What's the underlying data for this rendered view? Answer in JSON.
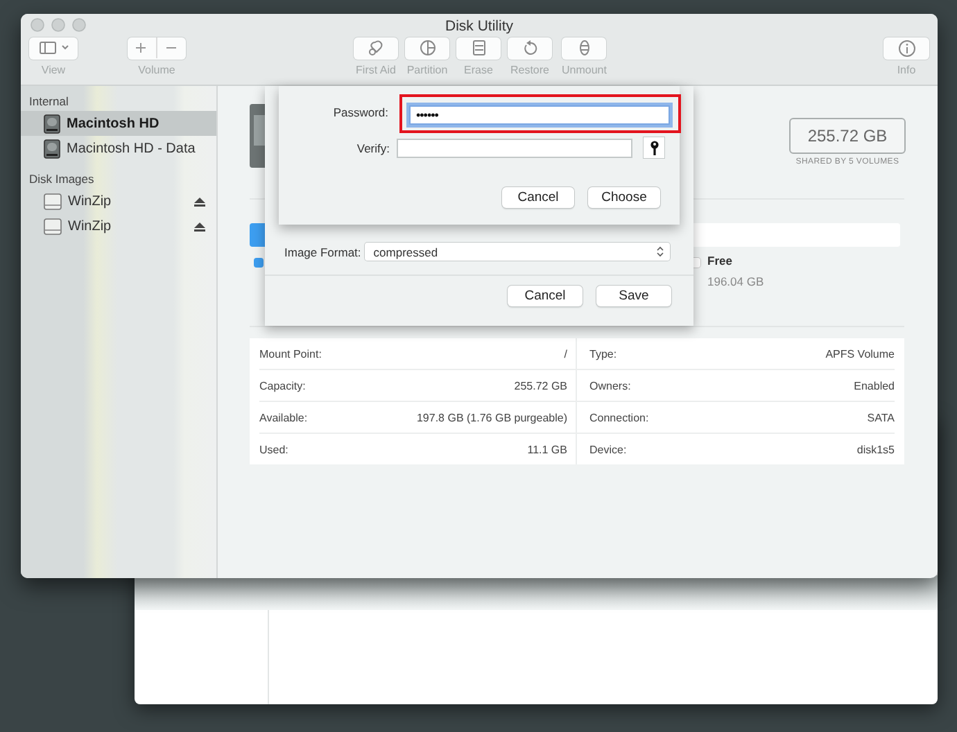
{
  "window": {
    "title": "Disk Utility"
  },
  "toolbar": [
    {
      "kind": "view",
      "label": "View"
    },
    {
      "kind": "volume",
      "label": "Volume"
    },
    {
      "kind": "first_aid",
      "label": "First Aid"
    },
    {
      "kind": "partition",
      "label": "Partition"
    },
    {
      "kind": "erase",
      "label": "Erase"
    },
    {
      "kind": "restore",
      "label": "Restore"
    },
    {
      "kind": "unmount",
      "label": "Unmount"
    },
    {
      "kind": "info",
      "label": "Info"
    }
  ],
  "sidebar": {
    "sections": [
      {
        "heading": "Internal",
        "items": [
          {
            "kind": "drive",
            "label": "Macintosh HD",
            "selected": true,
            "ejectable": false
          },
          {
            "kind": "drive",
            "label": "Macintosh HD - Data",
            "selected": false,
            "ejectable": false
          }
        ]
      },
      {
        "heading": "Disk Images",
        "items": [
          {
            "kind": "image",
            "label": "WinZip",
            "selected": false,
            "ejectable": true
          },
          {
            "kind": "image",
            "label": "WinZip",
            "selected": false,
            "ejectable": true
          }
        ]
      }
    ]
  },
  "volume": {
    "capacity": "255.72 GB",
    "capacity_note": "SHARED BY 5 VOLUMES",
    "legend": [
      {
        "color": "#3d9ef0"
      },
      {
        "label": "Free",
        "value": "196.04 GB",
        "color": "#ffffff"
      }
    ],
    "info": [
      {
        "label": "Mount Point:",
        "value": "/"
      },
      {
        "label": "Type:",
        "value": "APFS Volume"
      },
      {
        "label": "Capacity:",
        "value": "255.72 GB"
      },
      {
        "label": "Owners:",
        "value": "Enabled"
      },
      {
        "label": "Available:",
        "value": "197.8 GB (1.76 GB purgeable)"
      },
      {
        "label": "Connection:",
        "value": "SATA"
      },
      {
        "label": "Used:",
        "value": "11.1 GB"
      },
      {
        "label": "Device:",
        "value": "disk1s5"
      }
    ]
  },
  "save_sheet": {
    "format_label": "Image Format:",
    "format_value": "compressed",
    "buttons": [
      {
        "label": "Cancel",
        "default": false
      },
      {
        "label": "Save",
        "default": false
      }
    ]
  },
  "password_sheet": {
    "password_label": "Password:",
    "password_value": "••••••",
    "highlighted": true,
    "verify_label": "Verify:",
    "buttons": [
      {
        "label": "Cancel",
        "default": false
      },
      {
        "label": "Choose",
        "default": false
      }
    ]
  }
}
